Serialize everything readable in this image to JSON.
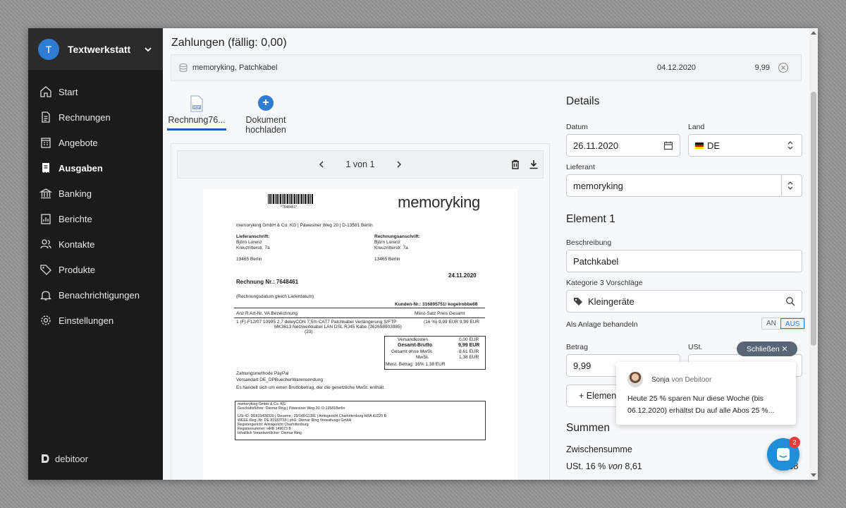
{
  "sidebar": {
    "company_initial": "T",
    "company_name": "Textwerkstatt",
    "items": [
      {
        "label": "Start",
        "icon": "home-icon"
      },
      {
        "label": "Rechnungen",
        "icon": "invoice-icon"
      },
      {
        "label": "Angebote",
        "icon": "quote-icon"
      },
      {
        "label": "Ausgaben",
        "icon": "receipt-icon"
      },
      {
        "label": "Banking",
        "icon": "bank-icon"
      },
      {
        "label": "Berichte",
        "icon": "chart-icon"
      },
      {
        "label": "Kontakte",
        "icon": "contacts-icon"
      },
      {
        "label": "Produkte",
        "icon": "tag-icon"
      },
      {
        "label": "Benachrichtigungen",
        "icon": "bell-icon"
      },
      {
        "label": "Einstellungen",
        "icon": "gear-icon"
      }
    ],
    "active_item": "Ausgaben",
    "brand": "debitoor"
  },
  "main": {
    "payments_title": "Zahlungen (fällig: 0,00)",
    "payment": {
      "description": "memoryking, Patchkabel",
      "date": "04.12.2020",
      "amount": "9,99"
    },
    "doc_tab_label": "Rechnung76...",
    "upload_label_1": "Dokument",
    "upload_label_2": "hochladen",
    "pager": "1 von 1"
  },
  "invoice": {
    "logo_a": "memory",
    "logo_b": "king",
    "barcode_number": "*7648461*",
    "sender_line": "memoryking GmbH & Co. KG | Päwesiner Weg 20 | D-13581 Berlin",
    "lief_title": "Lieferanschrift:",
    "rech_title": "Rechnungsanschrift:",
    "name": "Björn Lorenz",
    "street": "Kreuzritterstr. 7a",
    "city": "13465 Berlin",
    "date": "24.11.2020",
    "number": "Rechnung Nr.: 7648461",
    "note": "(Rechnungsdatum gleich Lieferdatum)",
    "customer": "Kunden-Nr.: 316895751/ kogelrobbe68",
    "table_header": "Anz      R      Art-Nr.     VA    Bezeichnung",
    "table_header_right": "Mwst-Satz    Preis    Gesamt",
    "row_left": "1    (F)-F12/07   10995   2,7   deleyCON 7,5m CAT7 Patchkabel Verlängerung S/FTP",
    "row_left2": "MK3613                     Netzwerkkabel LAN DSL RJ45 Kabe (362698903985)",
    "row_left3": "(23)",
    "row_right": "(16 %)   9,99 EUR    9,99 EUR",
    "versand": "Versandkosten",
    "versand_val": "0,00 EUR",
    "brutto": "Gesamt-Brutto",
    "brutto_val": "9,99 EUR",
    "netto": "Gesamt ohne MwSt.",
    "netto_val": "8,61 EUR",
    "mwst": "MwSt.",
    "mwst_val": "1,38 EUR",
    "mwst_betrag": "Mwst. Betrag:        16%        1,38 EUR",
    "zahlung": "Zahlungsmethode   PayPal",
    "versandart": "Versandart           DE_DPBuecherWarensendung",
    "brutto_note": "Es handelt sich um einen Bruttobetrag, der die gesetzliche MwSt. enthält.",
    "footer_1": "memoryking GmbH & Co. KG",
    "footer_2": "Geschäftsführer: Diemar Ring | Päwesiner Weg 20, D-13581Berlin",
    "footer_3": "USt-ID: DE815428330 | Steuernr.: 29/148/11381 | Amtsgericht Charlottenburg HRA 41220 B",
    "footer_4": "WEEE-Reg.-Nr. DE 81933733 | phG: Diemar Ring Verwaltungs GmbH",
    "footer_5": "Registergericht: Amtsgericht Charlottenburg",
    "footer_6": "Registernummer: HRB 149673 B",
    "footer_7": "Inhaltlich Verantwortlicher: Diemar Ring"
  },
  "details": {
    "title": "Details",
    "datum_label": "Datum",
    "datum_value": "26.11.2020",
    "land_label": "Land",
    "land_value": "DE",
    "lieferant_label": "Lieferant",
    "lieferant_value": "memoryking",
    "element_title": "Element 1",
    "beschreibung_label": "Beschreibung",
    "beschreibung_value": "Patchkabel",
    "kategorie_label": "Kategorie 3 Vorschläge",
    "kategorie_value": "Kleingeräte",
    "anlage_label": "Als Anlage behandeln",
    "toggle_an": "AN",
    "toggle_aus": "AUS",
    "betrag_label": "Betrag",
    "betrag_value": "9,99",
    "ust_label": "USt.",
    "add_element": "+ Element",
    "summen_title": "Summen",
    "zwischensumme": "Zwischensumme",
    "ust_row_a": "USt. 16 %",
    "ust_row_b": "von",
    "ust_row_c": "8,61",
    "ust_row_value": "1,38"
  },
  "chat": {
    "close_label": "Schließen ✕",
    "agent": "Sonja",
    "from": "von Debitoor",
    "message": "Heute 25 % sparen Nur diese Woche (bis 06.12.2020) erhältst Du auf alle Abos 25 %...",
    "badge": "2"
  },
  "colors": {
    "accent": "#2f7dd3",
    "sidebar": "#1b1b1b",
    "active_tab": "#1a5fb4"
  }
}
